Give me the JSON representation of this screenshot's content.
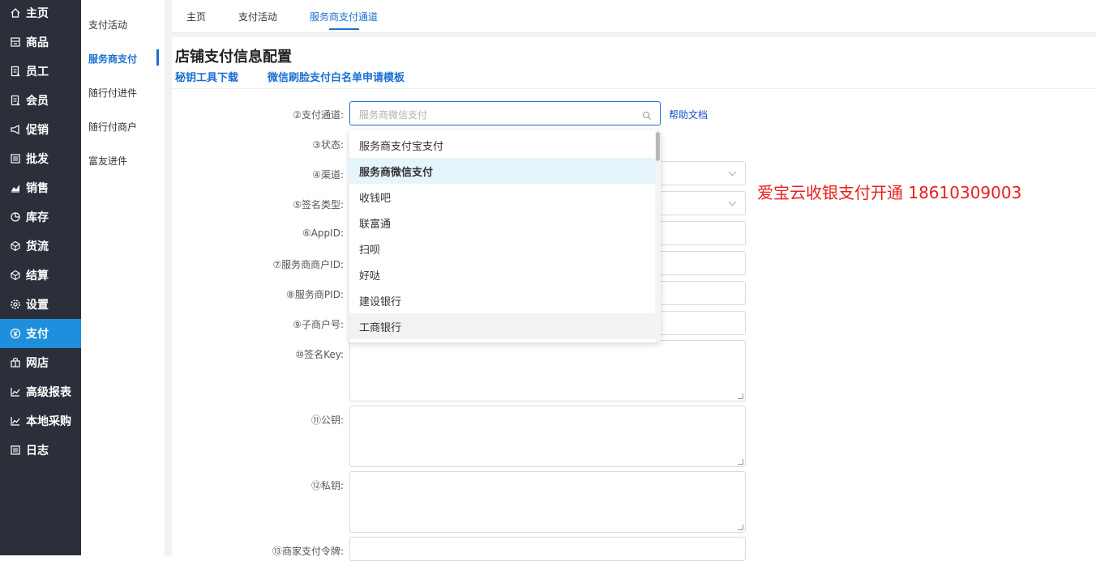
{
  "nav": {
    "items": [
      {
        "label": "主页",
        "icon": "home-icon"
      },
      {
        "label": "商品",
        "icon": "store-icon"
      },
      {
        "label": "员工",
        "icon": "staff-icon"
      },
      {
        "label": "会员",
        "icon": "member-icon"
      },
      {
        "label": "促销",
        "icon": "megaphone-icon"
      },
      {
        "label": "批发",
        "icon": "list-icon"
      },
      {
        "label": "销售",
        "icon": "bar-chart-icon"
      },
      {
        "label": "库存",
        "icon": "pie-chart-icon"
      },
      {
        "label": "货流",
        "icon": "cube-icon"
      },
      {
        "label": "结算",
        "icon": "cube-icon"
      },
      {
        "label": "设置",
        "icon": "gear-icon"
      },
      {
        "label": "支付",
        "icon": "yen-icon"
      },
      {
        "label": "网店",
        "icon": "shop-icon"
      },
      {
        "label": "高级报表",
        "icon": "line-chart-icon"
      },
      {
        "label": "本地采购",
        "icon": "line-chart-icon"
      },
      {
        "label": "日志",
        "icon": "list-icon"
      }
    ],
    "active": "支付"
  },
  "subnav": {
    "items": [
      "支付活动",
      "服务商支付",
      "随行付进件",
      "随行付商户",
      "富友进件"
    ],
    "active": "服务商支付"
  },
  "tabs": {
    "items": [
      "主页",
      "支付活动",
      "服务商支付通道"
    ],
    "active": "服务商支付通道"
  },
  "page": {
    "title": "店铺支付信息配置",
    "link_tools": "秘钥工具下载",
    "link_whitelist": "微信刷脸支付白名单申请模板"
  },
  "form": {
    "channel_label": "②支付通道:",
    "channel_placeholder": "服务商微信支付",
    "help_link": "帮助文档",
    "status_label": "③状态:",
    "route_label": "④渠道:",
    "sign_type_label": "⑤签名类型:",
    "appid_label": "⑥AppID:",
    "merchant_id_label": "⑦服务商商户ID:",
    "pid_label": "⑧服务商PID:",
    "sub_merchant_label": "⑨子商户号:",
    "sign_key_label": "⑩签名Key:",
    "public_key_label": "⑪公钥:",
    "private_key_label": "⑫私钥:",
    "token_label": "⑬商家支付令牌:"
  },
  "dropdown": {
    "options": [
      "服务商支付宝支付",
      "服务商微信支付",
      "收钱吧",
      "联富通",
      "扫呗",
      "好哒",
      "建设银行",
      "工商银行"
    ],
    "selected": "服务商微信支付",
    "hovered": "工商银行"
  },
  "promo": {
    "text": "爱宝云收银支付开通  18610309003"
  },
  "colors": {
    "sidebar_bg": "#2b2f3a",
    "active_blue": "#1f8fdd",
    "link_blue": "#1a6fd0",
    "promo_red": "#e8201b"
  }
}
